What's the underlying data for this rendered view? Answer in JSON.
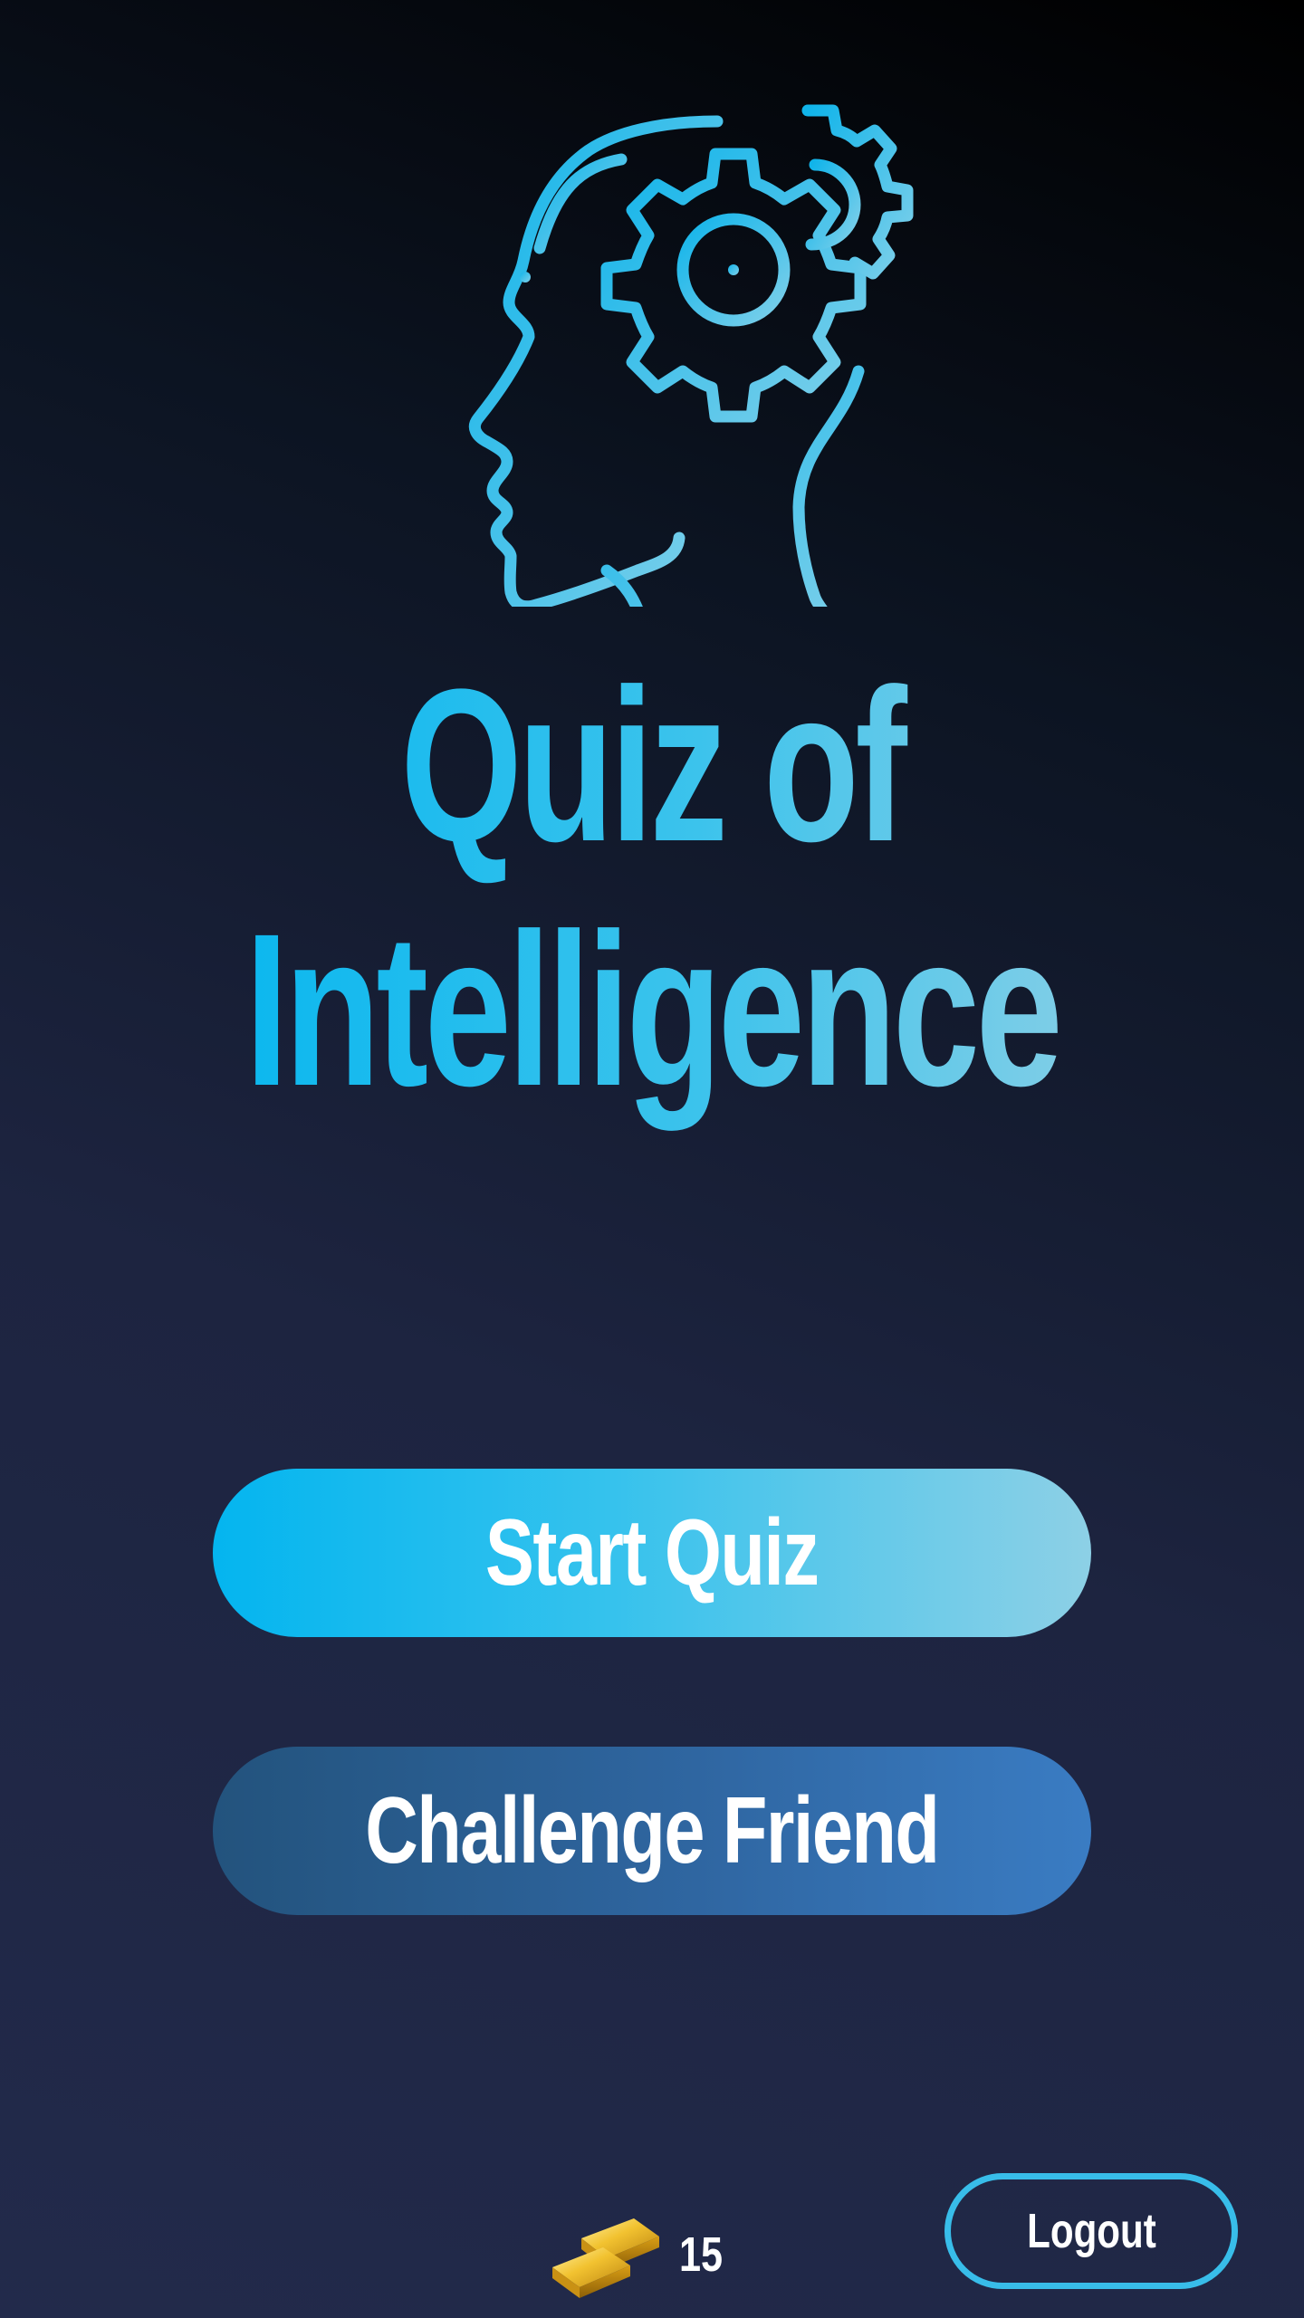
{
  "app": {
    "title_line1": "Quiz of",
    "title_line2": "Intelligence",
    "logo_icon": "head-with-gear-icon"
  },
  "actions": {
    "start_label": "Start Quiz",
    "challenge_label": "Challenge Friend",
    "logout_label": "Logout"
  },
  "wallet": {
    "icon": "gold-bars-icon",
    "coins": "15"
  },
  "colors": {
    "accent": "#06b6ef",
    "accent_light": "#8dd0e6",
    "secondary_button": "#2f66a1",
    "background_dark": "#000000",
    "background_navy": "#222a4b"
  }
}
